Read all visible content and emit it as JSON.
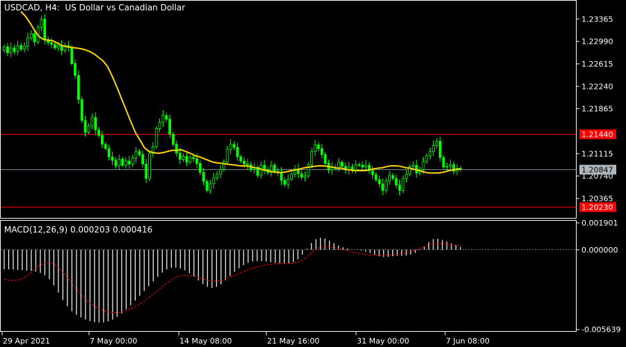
{
  "header": {
    "symbol_timeframe": "USDCAD, H4:",
    "description": "US Dollar vs Canadian Dollar"
  },
  "indicator": {
    "macd_label": "MACD(12,26,9) 0.000203 0.000416"
  },
  "colors": {
    "background": "#000000",
    "frame": "#ffffff",
    "candle": "#00ff00",
    "moving_average": "#ffd700",
    "resistance_line": "#ff0000",
    "price_badge_red": "#ff0000",
    "current_price_line": "#778899",
    "current_price_badge": "#b0b8c0",
    "macd_histogram": "#ffffff",
    "signal_line": "#ff0000",
    "zero_line": "#808080"
  },
  "chart_data": [
    {
      "type": "candlestick",
      "title": "USDCAD, H4:  US Dollar vs Canadian Dollar",
      "y_ticks": [
        "1.23365",
        "1.22990",
        "1.22615",
        "1.22240",
        "1.21865",
        "1.21115",
        "1.20740",
        "1.20365"
      ],
      "x_ticks": [
        "29 Apr 2021",
        "7 May 00:00",
        "14 May 08:00",
        "21 May 16:00",
        "31 May 00:00",
        "7 Jun 08:00"
      ],
      "ylim": [
        1.2004,
        1.2367
      ],
      "grid": false,
      "horizontal_lines": [
        {
          "price": 1.2144,
          "label": "1.21440",
          "color": "red"
        },
        {
          "price": 1.2023,
          "label": "1.20230",
          "color": "red"
        },
        {
          "price": 1.20847,
          "label": "1.20847",
          "color": "gray",
          "current_price": true
        }
      ],
      "close": [
        1.229,
        1.228,
        1.2288,
        1.2282,
        1.2292,
        1.2286,
        1.2291,
        1.2305,
        1.2312,
        1.2298,
        1.2322,
        1.2336,
        1.2302,
        1.2297,
        1.2294,
        1.2288,
        1.2292,
        1.2284,
        1.2292,
        1.2289,
        1.2262,
        1.2242,
        1.2202,
        1.2167,
        1.2147,
        1.2158,
        1.2172,
        1.2151,
        1.2142,
        1.2127,
        1.212,
        1.2106,
        1.21,
        1.2091,
        1.2102,
        1.2092,
        1.2099,
        1.2094,
        1.2104,
        1.2115,
        1.211,
        1.2094,
        1.207,
        1.2112,
        1.2123,
        1.2153,
        1.2164,
        1.2175,
        1.2169,
        1.2144,
        1.2127,
        1.2112,
        1.2102,
        1.2107,
        1.2097,
        1.2105,
        1.2103,
        1.2095,
        1.208,
        1.2065,
        1.205,
        1.2061,
        1.2071,
        1.2077,
        1.2085,
        1.2098,
        1.2118,
        1.2127,
        1.2122,
        1.2106,
        1.2099,
        1.2094,
        1.2093,
        1.2085,
        1.2088,
        1.2075,
        1.2092,
        1.2085,
        1.208,
        1.2092,
        1.2082,
        1.208,
        1.2067,
        1.206,
        1.2069,
        1.2077,
        1.2086,
        1.2078,
        1.2072,
        1.2074,
        1.2093,
        1.2115,
        1.2126,
        1.212,
        1.211,
        1.2095,
        1.2084,
        1.2088,
        1.2088,
        1.2097,
        1.209,
        1.2084,
        1.2089,
        1.2084,
        1.2093,
        1.2092,
        1.2089,
        1.2092,
        1.2083,
        1.2076,
        1.2068,
        1.2061,
        1.205,
        1.2066,
        1.2075,
        1.207,
        1.2059,
        1.205,
        1.207,
        1.2077,
        1.209,
        1.2092,
        1.2079,
        1.2085,
        1.2098,
        1.2108,
        1.2115,
        1.2125,
        1.2132,
        1.2105,
        1.2089,
        1.209,
        1.2093,
        1.2082,
        1.2087,
        1.2085
      ],
      "moving_average": [
        1.2349,
        1.2341,
        1.233,
        1.2317,
        1.2307,
        1.2302,
        1.2301,
        1.23,
        1.2296,
        1.2292,
        1.229,
        1.2289,
        1.2288,
        1.2287,
        1.2285,
        1.2282,
        1.2278,
        1.2272,
        1.2266,
        1.2256,
        1.224,
        1.2222,
        1.2203,
        1.2184,
        1.2165,
        1.2147,
        1.2134,
        1.2121,
        1.2115,
        1.2113,
        1.2112,
        1.2113,
        1.2115,
        1.2117,
        1.2117,
        1.2118,
        1.2115,
        1.2112,
        1.2108,
        1.2106,
        1.2103,
        1.21,
        1.2097,
        1.2096,
        1.2095,
        1.2094,
        1.2093,
        1.2092,
        1.2091,
        1.2091,
        1.209,
        1.2088,
        1.2087,
        1.2084,
        1.2083,
        1.2081,
        1.208,
        1.208,
        1.2081,
        1.2083,
        1.2084,
        1.2086,
        1.2088,
        1.2089,
        1.209,
        1.2091,
        1.2091,
        1.209,
        1.2089,
        1.2087,
        1.2087,
        1.2085,
        1.2084,
        1.2083,
        1.2083,
        1.2083,
        1.2084,
        1.2086,
        1.2087,
        1.2088,
        1.209,
        1.2091,
        1.2091,
        1.209,
        1.2088,
        1.2087,
        1.2085,
        1.2083,
        1.2081,
        1.2079,
        1.2079,
        1.2079,
        1.208,
        1.2082,
        1.2084,
        1.2085,
        1.2086
      ],
      "ma_start_index": 0
    },
    {
      "type": "bar",
      "title": "MACD(12,26,9) 0.000203 0.000416",
      "y_ticks": [
        "0.001901",
        "0.000000",
        "-0.005639"
      ],
      "ylim": [
        -0.00575,
        0.00205
      ],
      "zero_line": 0.0,
      "histogram": [
        -0.00138,
        -0.00139,
        -0.00141,
        -0.00143,
        -0.00145,
        -0.00147,
        -0.0015,
        -0.00155,
        -0.00164,
        -0.00181,
        -0.00208,
        -0.00251,
        -0.00303,
        -0.00356,
        -0.00401,
        -0.00435,
        -0.0046,
        -0.00479,
        -0.00494,
        -0.00505,
        -0.00512,
        -0.00515,
        -0.00514,
        -0.00507,
        -0.00494,
        -0.00475,
        -0.00451,
        -0.00423,
        -0.00393,
        -0.0036,
        -0.00326,
        -0.00292,
        -0.00258,
        -0.00224,
        -0.00192,
        -0.00162,
        -0.0014,
        -0.00128,
        -0.00126,
        -0.00132,
        -0.00146,
        -0.00166,
        -0.00191,
        -0.00218,
        -0.00243,
        -0.00262,
        -0.0027,
        -0.00263,
        -0.00244,
        -0.00216,
        -0.00186,
        -0.00157,
        -0.00131,
        -0.00109,
        -0.00093,
        -0.00084,
        -0.0008,
        -0.00081,
        -0.00084,
        -0.00089,
        -0.00093,
        -0.00096,
        -0.00097,
        -0.00096,
        -0.00089,
        -0.00069,
        -0.00035,
        8e-05,
        0.00048,
        0.00075,
        0.00084,
        0.00079,
        0.00064,
        0.00046,
        0.00029,
        0.00017,
        8e-05,
        3e-05,
        -1e-05,
        -6e-05,
        -0.00013,
        -0.00023,
        -0.00036,
        -0.00047,
        -0.00052,
        -0.0005,
        -0.00046,
        -0.00044,
        -0.00043,
        -0.00041,
        -0.00035,
        -0.00023,
        -3e-05,
        0.00024,
        0.00054,
        0.00075,
        0.00078,
        0.0007,
        0.00058,
        0.00045,
        0.00033,
        0.0002
      ],
      "signal": [
        -0.0021,
        -0.00215,
        -0.00218,
        -0.00215,
        -0.00205,
        -0.00185,
        -0.00158,
        -0.00132,
        -0.00108,
        -0.00093,
        -0.0009,
        -0.001,
        -0.00125,
        -0.0016,
        -0.002,
        -0.00241,
        -0.00281,
        -0.00318,
        -0.0035,
        -0.00378,
        -0.004,
        -0.00418,
        -0.00431,
        -0.0044,
        -0.00445,
        -0.00445,
        -0.0044,
        -0.00431,
        -0.00418,
        -0.00402,
        -0.00383,
        -0.00361,
        -0.00338,
        -0.00313,
        -0.00288,
        -0.00262,
        -0.00237,
        -0.00214,
        -0.00196,
        -0.00184,
        -0.0018,
        -0.00182,
        -0.00188,
        -0.00197,
        -0.00207,
        -0.00216,
        -0.00222,
        -0.00223,
        -0.00218,
        -0.00208,
        -0.00195,
        -0.00181,
        -0.00168,
        -0.00155,
        -0.00143,
        -0.00132,
        -0.00122,
        -0.00114,
        -0.00107,
        -0.00102,
        -0.00099,
        -0.00098,
        -0.00098,
        -0.00098,
        -0.00096,
        -0.00089,
        -0.00074,
        -0.00051,
        -0.00023,
        3e-05,
        0.00019,
        0.00024,
        0.00022,
        0.00016,
        8e-05,
        0.0,
        -8e-05,
        -0.00016,
        -0.00024,
        -0.00031,
        -0.00036,
        -0.00039,
        -0.0004,
        -0.0004,
        -0.0004,
        -0.00038,
        -0.00036,
        -0.00033,
        -0.00028,
        -0.00022,
        -0.00014,
        -4e-05,
        8e-05,
        0.00021,
        0.00033,
        0.00041,
        0.00044,
        0.00043,
        0.0004,
        0.00036,
        0.00032,
        0.00028
      ]
    }
  ]
}
